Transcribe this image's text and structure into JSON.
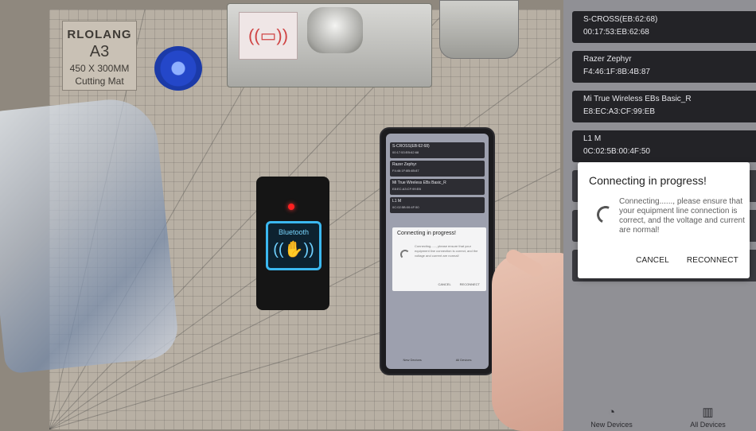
{
  "scene": {
    "mat": {
      "brand": "RLOLANG",
      "size": "A3",
      "dimensions": "450 X 300MM",
      "name": "Cutting Mat"
    },
    "reader": {
      "label": "Bluetooth"
    },
    "small_phone": {
      "devices": [
        {
          "name": "S-CROSS(EB:62:68)",
          "mac": "00:17:53:EB:62:68"
        },
        {
          "name": "Razer Zephyr",
          "mac": "F4:46:1F:8B:4B:87"
        },
        {
          "name": "Mi True Wireless EBs Basic_R",
          "mac": "E8:EC:A3:CF:99:EB"
        },
        {
          "name": "L1 M",
          "mac": "0C:02:5B:00:4F:50"
        }
      ],
      "dialog_title": "Connecting in progress!",
      "dialog_message": "Connecting......, please ensure that your equipment line connection is correct, and the voltage and current are normal!",
      "cancel": "CANCEL",
      "reconnect": "RECONNECT",
      "nav_new": "New Devices",
      "nav_all": "All Devices"
    }
  },
  "panel": {
    "devices": [
      {
        "name": "S-CROSS(EB:62:68)",
        "mac": "00:17:53:EB:62:68"
      },
      {
        "name": "Razer Zephyr",
        "mac": "F4:46:1F:8B:4B:87"
      },
      {
        "name": "Mi True Wireless EBs Basic_R",
        "mac": "E8:EC:A3:CF:99:EB"
      },
      {
        "name": "L1 M",
        "mac": "0C:02:5B:00:4F:50"
      }
    ],
    "dialog": {
      "title": "Connecting in progress!",
      "message": "Connecting......, please ensure that your equipment line connection is correct, and the voltage and current are normal!",
      "cancel_label": "CANCEL",
      "reconnect_label": "RECONNECT"
    },
    "nav": {
      "new_devices_label": "New Devices",
      "new_devices_icon": "bluetooth-scan-icon",
      "all_devices_label": "All Devices",
      "all_devices_icon": "device-list-icon"
    }
  },
  "colors": {
    "panel_bg": "#909095",
    "device_card": "#232327",
    "dialog_bg": "#ffffff",
    "reader_glow": "#3bb8f0",
    "led_red": "#ff2020"
  }
}
